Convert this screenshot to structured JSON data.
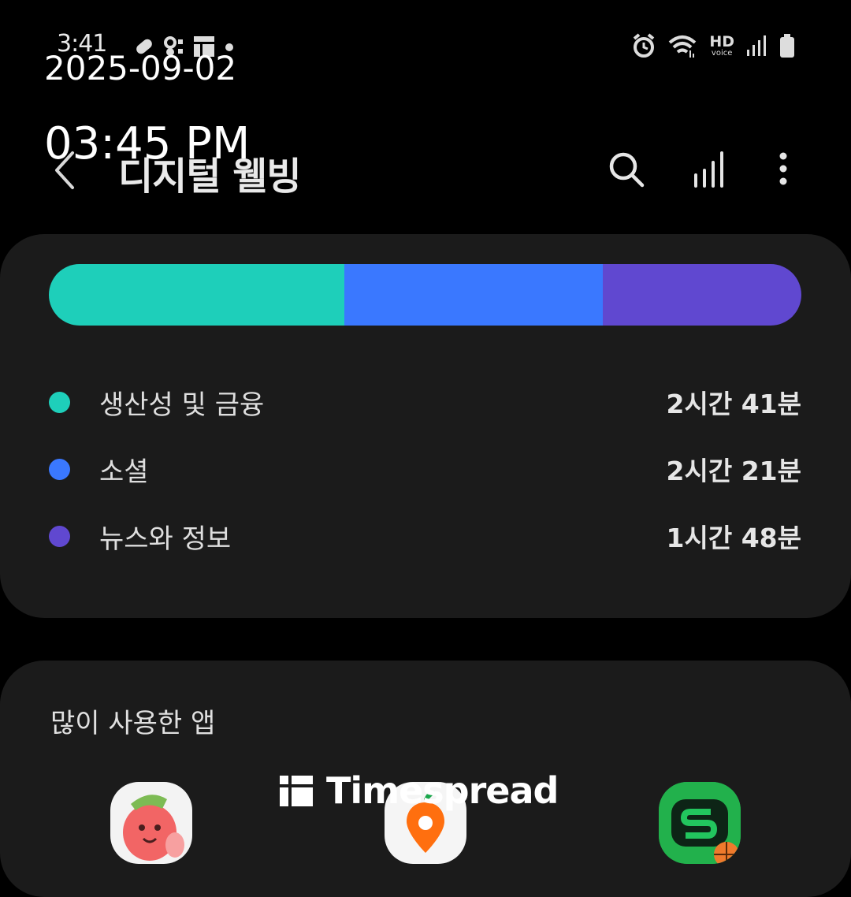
{
  "status_bar": {
    "time": "3:41",
    "left_icons": [
      "link-icon",
      "notification-icon",
      "grid-app-icon",
      "dot-icon"
    ],
    "right_icons": [
      "alarm-icon",
      "wifi-icon",
      "hd-voice-icon",
      "signal-icon",
      "battery-icon"
    ],
    "hd_label": "HD",
    "voice_label": "voice"
  },
  "overlay": {
    "date": "2025-09-02",
    "time": "03:45 PM"
  },
  "header": {
    "title": "디지털 웰빙",
    "back_icon": "chevron-left-icon",
    "actions": [
      "search-icon",
      "bar-chart-icon",
      "more-vert-icon"
    ]
  },
  "categories": {
    "colors": [
      "#1ecfba",
      "#3a78ff",
      "#6048d0"
    ],
    "items": [
      {
        "label": "생산성 및 금융",
        "time": "2시간 41분",
        "minutes": 161,
        "color": "#1ecfba"
      },
      {
        "label": "소셜",
        "time": "2시간 21분",
        "minutes": 141,
        "color": "#3a78ff"
      },
      {
        "label": "뉴스와 정보",
        "time": "1시간 48분",
        "minutes": 108,
        "color": "#6048d0"
      }
    ]
  },
  "apps": {
    "title": "많이 사용한 앱",
    "icons": [
      "peach-character-app-icon",
      "orange-location-app-icon",
      "green-sports-app-icon"
    ]
  },
  "watermark": {
    "text": "Timespread"
  }
}
